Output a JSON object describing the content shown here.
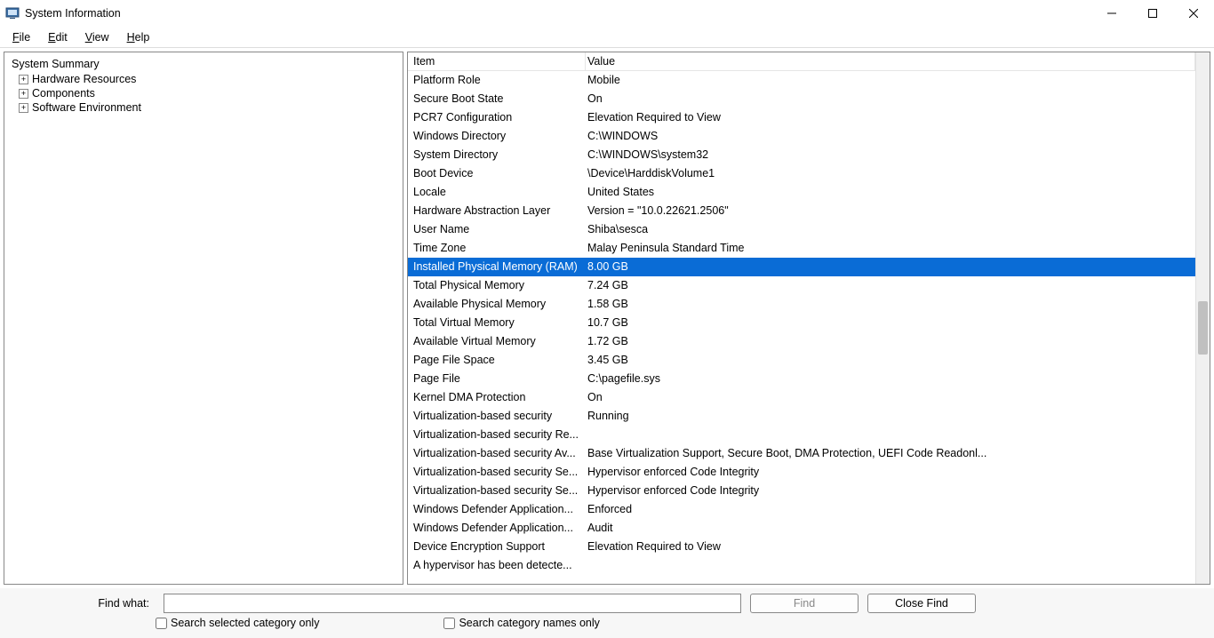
{
  "window": {
    "title": "System Information"
  },
  "menu": {
    "file": "File",
    "edit": "Edit",
    "view": "View",
    "help": "Help"
  },
  "tree": {
    "root": "System Summary",
    "children": [
      {
        "label": "Hardware Resources"
      },
      {
        "label": "Components"
      },
      {
        "label": "Software Environment"
      }
    ]
  },
  "columns": {
    "item": "Item",
    "value": "Value"
  },
  "rows": [
    {
      "item": "Platform Role",
      "value": "Mobile"
    },
    {
      "item": "Secure Boot State",
      "value": "On"
    },
    {
      "item": "PCR7 Configuration",
      "value": "Elevation Required to View"
    },
    {
      "item": "Windows Directory",
      "value": "C:\\WINDOWS"
    },
    {
      "item": "System Directory",
      "value": "C:\\WINDOWS\\system32"
    },
    {
      "item": "Boot Device",
      "value": "\\Device\\HarddiskVolume1"
    },
    {
      "item": "Locale",
      "value": "United States"
    },
    {
      "item": "Hardware Abstraction Layer",
      "value": "Version = \"10.0.22621.2506\""
    },
    {
      "item": "User Name",
      "value": "Shiba\\sesca"
    },
    {
      "item": "Time Zone",
      "value": "Malay Peninsula Standard Time"
    },
    {
      "item": "Installed Physical Memory (RAM)",
      "value": "8.00 GB",
      "selected": true
    },
    {
      "item": "Total Physical Memory",
      "value": "7.24 GB"
    },
    {
      "item": "Available Physical Memory",
      "value": "1.58 GB"
    },
    {
      "item": "Total Virtual Memory",
      "value": "10.7 GB"
    },
    {
      "item": "Available Virtual Memory",
      "value": "1.72 GB"
    },
    {
      "item": "Page File Space",
      "value": "3.45 GB"
    },
    {
      "item": "Page File",
      "value": "C:\\pagefile.sys"
    },
    {
      "item": "Kernel DMA Protection",
      "value": "On"
    },
    {
      "item": "Virtualization-based security",
      "value": "Running"
    },
    {
      "item": "Virtualization-based security Re...",
      "value": ""
    },
    {
      "item": "Virtualization-based security Av...",
      "value": "Base Virtualization Support, Secure Boot, DMA Protection, UEFI Code Readonl..."
    },
    {
      "item": "Virtualization-based security Se...",
      "value": "Hypervisor enforced Code Integrity"
    },
    {
      "item": "Virtualization-based security Se...",
      "value": "Hypervisor enforced Code Integrity"
    },
    {
      "item": "Windows Defender Application...",
      "value": "Enforced"
    },
    {
      "item": "Windows Defender Application...",
      "value": "Audit"
    },
    {
      "item": "Device Encryption Support",
      "value": "Elevation Required to View"
    },
    {
      "item": "A hypervisor has been detecte...",
      "value": ""
    }
  ],
  "findbar": {
    "label": "Find what:",
    "input_value": "",
    "find_btn": "Find",
    "close_btn": "Close Find",
    "chk_selected": "Search selected category only",
    "chk_names": "Search category names only"
  }
}
